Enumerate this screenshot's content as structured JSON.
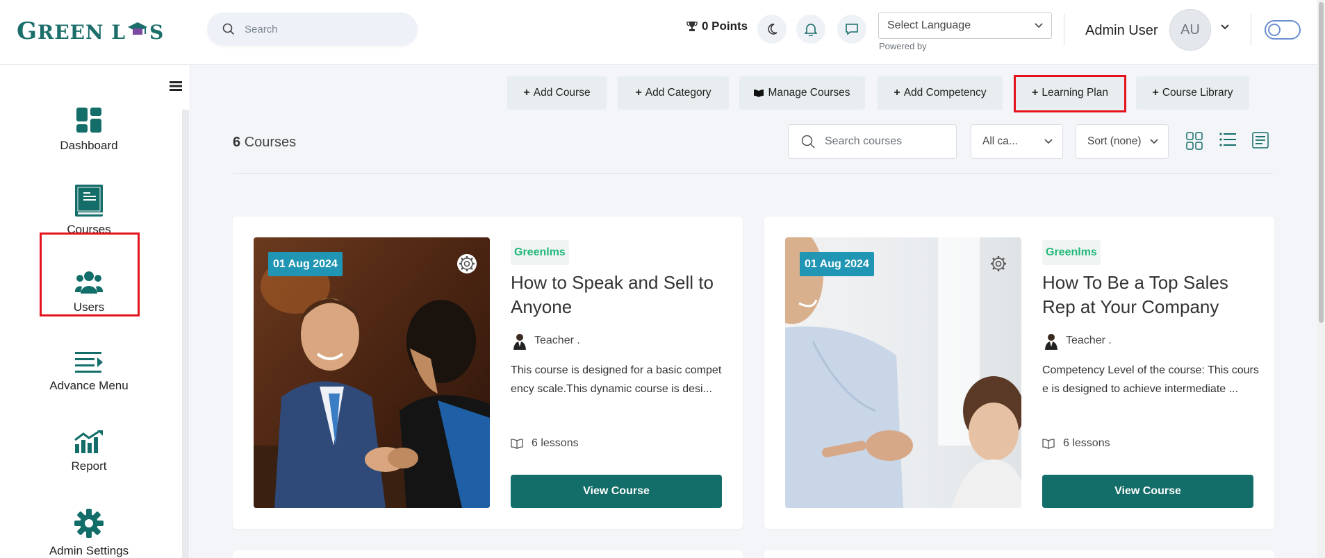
{
  "app": {
    "logo_text_1": "G",
    "logo_text_2": "REEN L",
    "logo_text_3": "S",
    "brand_color": "#136d68"
  },
  "header": {
    "search_placeholder": "Search",
    "points": "0 Points",
    "language_placeholder": "Select Language",
    "powered_by": "Powered by",
    "user_name": "Admin User",
    "avatar_initials": "AU"
  },
  "sidebar": {
    "items": [
      {
        "label": "Dashboard",
        "icon": "dashboard-icon"
      },
      {
        "label": "Courses",
        "icon": "book-icon",
        "active": true
      },
      {
        "label": "Users",
        "icon": "users-icon"
      },
      {
        "label": "Advance Menu",
        "icon": "menu-arrow-icon"
      },
      {
        "label": "Report",
        "icon": "chart-icon"
      },
      {
        "label": "Admin Settings",
        "icon": "gear-icon"
      }
    ]
  },
  "toolbar": {
    "add_course": "Add Course",
    "add_category": "Add Category",
    "manage_courses": "Manage Courses",
    "add_competency": "Add Competency",
    "learning_plan": "Learning Plan",
    "course_library": "Course Library"
  },
  "list": {
    "count": "6",
    "count_label": "Courses",
    "search_placeholder": "Search courses",
    "category_filter": "All ca...",
    "sort": "Sort (none)"
  },
  "courses": [
    {
      "date": "01 Aug 2024",
      "tag": "Greenlms",
      "title": "How to Speak and Sell to Anyone",
      "teacher": "Teacher .",
      "description": "This course is designed for a basic competency scale.This dynamic course is desi...",
      "lessons": "6 lessons",
      "button": "View Course"
    },
    {
      "date": "01 Aug 2024",
      "tag": "Greenlms",
      "title": "How To Be a Top Sales Rep at Your Company",
      "teacher": "Teacher .",
      "description": "Competency Level of the course: This course is designed to achieve intermediate ...",
      "lessons": "6 lessons",
      "button": "View Course"
    }
  ]
}
